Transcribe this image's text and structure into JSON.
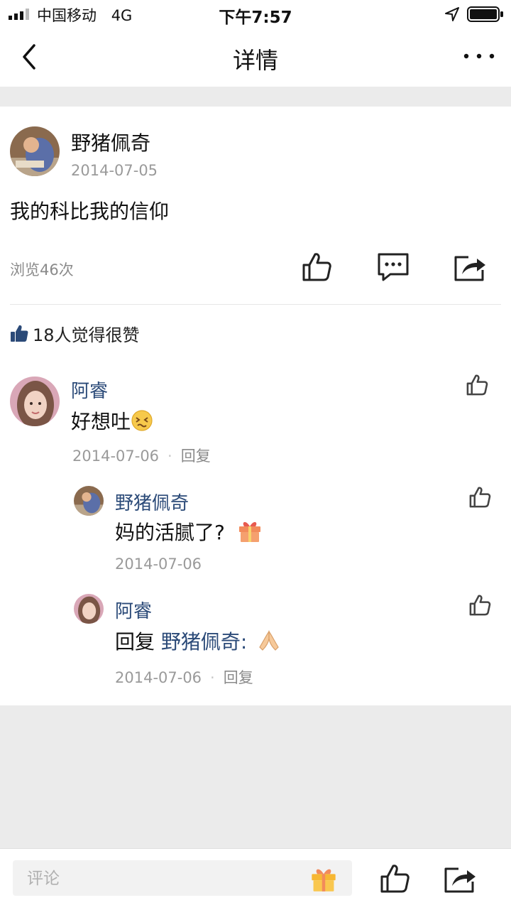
{
  "status_bar": {
    "carrier": "中国移动",
    "network": "4G",
    "time": "下午7:57"
  },
  "nav": {
    "title": "详情"
  },
  "post": {
    "author": "野猪佩奇",
    "date": "2014-07-05",
    "text": "我的科比我的信仰",
    "views": "浏览46次",
    "likes_summary": "18人觉得很赞"
  },
  "comments": [
    {
      "author": "阿睿",
      "text": "好想吐",
      "emoji": "dizzy-face-icon",
      "date": "2014-07-06",
      "reply_label": "回复",
      "replies": [
        {
          "author": "野猪佩奇",
          "text": "妈的活腻了?",
          "emoji": "gift-icon",
          "date": "2014-07-06"
        },
        {
          "author": "阿睿",
          "reply_prefix": "回复",
          "mention": "野猪佩奇:",
          "emoji": "folded-hands-icon",
          "date": "2014-07-06",
          "reply_label": "回复"
        }
      ]
    }
  ],
  "bottom_bar": {
    "comment_placeholder": "评论"
  },
  "colors": {
    "link": "#2b4a78",
    "muted": "#9a9a9a",
    "page_bg": "#ebebeb"
  }
}
